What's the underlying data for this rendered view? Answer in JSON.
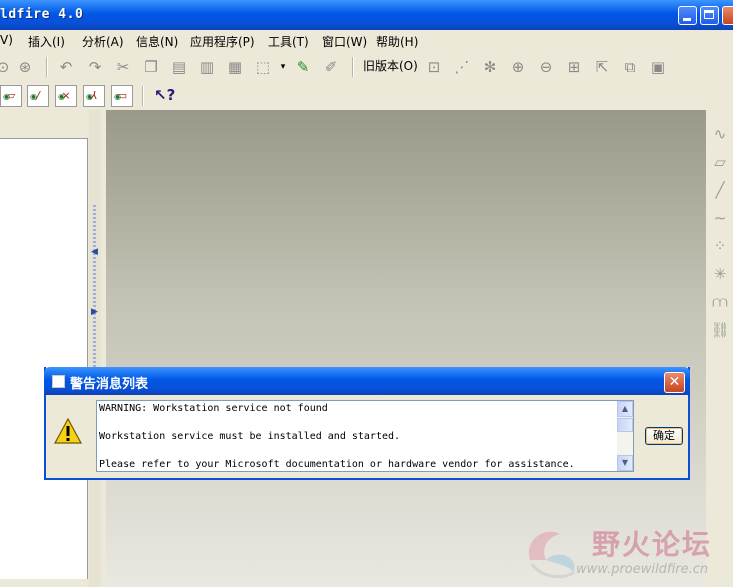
{
  "window": {
    "title": "ldfire 4.0"
  },
  "menu": {
    "items": [
      {
        "label": "V)"
      },
      {
        "label": "插入(I)"
      },
      {
        "label": "分析(A)"
      },
      {
        "label": "信息(N)"
      },
      {
        "label": "应用程序(P)"
      },
      {
        "label": "工具(T)"
      },
      {
        "label": "窗口(W)"
      },
      {
        "label": "帮助(H)"
      }
    ]
  },
  "toolbar": {
    "old_version_label": "旧版本(O)"
  },
  "dialog": {
    "title": "警告消息列表",
    "messages": [
      "WARNING: Workstation service not found",
      "Workstation service must be installed and started.",
      "Please refer to your Microsoft documentation or hardware vendor for assistance."
    ],
    "ok_label": "确定"
  },
  "watermark": {
    "text": "野火论坛",
    "url": "www.proewildfire.cn"
  },
  "icons": {
    "undo": "↶",
    "redo": "↷",
    "cut": "✂",
    "zoom_in": "⊕",
    "zoom_out": "⊖",
    "close": "✕",
    "help_cursor": "↖?"
  }
}
